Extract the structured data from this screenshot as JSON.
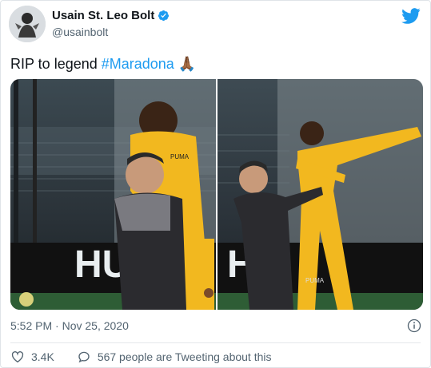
{
  "tweet": {
    "author_name": "Usain St. Leo Bolt",
    "handle": "@usainbolt",
    "text_prefix": "RIP to legend ",
    "hashtag": "#Maradona",
    "emoji": "🙏🏾",
    "timestamp": "5:52 PM · Nov 25, 2020",
    "likes": "3.4K",
    "conversation": "567 people are Tweeting about this"
  },
  "photos": [
    {
      "name": "bolt-hugging-maradona",
      "banner_text": "HU"
    },
    {
      "name": "bolt-and-maradona-lightning-pose",
      "banner_text": "H"
    }
  ],
  "colors": {
    "brand": "#1d9bf0",
    "text": "#0f1419",
    "secondary": "#536471",
    "puma_yellow": "#f2b81f"
  },
  "icons": [
    "verified-badge-icon",
    "twitter-bird-icon",
    "info-icon",
    "heart-icon",
    "chat-bubble-icon"
  ]
}
